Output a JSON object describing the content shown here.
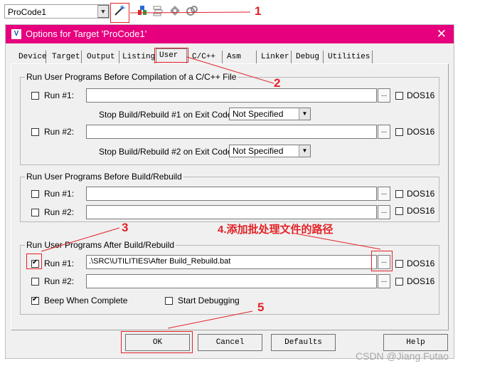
{
  "toolbar": {
    "target_value": "ProCode1",
    "icons": [
      "options-for-target-icon",
      "load-icon",
      "books-icon",
      "pack-installer-icon",
      "multi-project-icon"
    ]
  },
  "dialog": {
    "title": "Options for Target 'ProCode1'",
    "tabs": [
      "Device",
      "Target",
      "Output",
      "Listing",
      "User",
      "C/C++",
      "Asm",
      "Linker",
      "Debug",
      "Utilities"
    ],
    "active_tab": "User",
    "group_compile": {
      "legend": "Run User Programs Before Compilation of a C/C++ File",
      "run1_label": "Run #1:",
      "run1_value": "",
      "run1_checked": false,
      "run2_label": "Run #2:",
      "run2_value": "",
      "run2_checked": false,
      "dos16_label": "DOS16",
      "stop1_label": "Stop Build/Rebuild #1 on Exit Code:",
      "stop1_value": "Not Specified",
      "stop2_label": "Stop Build/Rebuild #2 on Exit Code:",
      "stop2_value": "Not Specified"
    },
    "group_before_build": {
      "legend": "Run User Programs Before Build/Rebuild",
      "run1_label": "Run #1:",
      "run1_value": "",
      "run2_label": "Run #2:",
      "run2_value": "",
      "dos16_label": "DOS16"
    },
    "group_after_build": {
      "legend": "Run User Programs After Build/Rebuild",
      "run1_label": "Run #1:",
      "run1_value": ".\\SRC\\UTILITIES\\After Build_Rebuild.bat",
      "run1_checked": true,
      "run2_label": "Run #2:",
      "run2_value": "",
      "dos16_label": "DOS16",
      "beep_label": "Beep When Complete",
      "beep_checked": true,
      "debug_label": "Start Debugging",
      "debug_checked": false
    },
    "browse_label": "...",
    "buttons": {
      "ok": "OK",
      "cancel": "Cancel",
      "defaults": "Defaults",
      "help": "Help"
    }
  },
  "annotations": {
    "n1": "1",
    "n2": "2",
    "n3": "3",
    "n4": "4.添加批处理文件的路径",
    "n5": "5",
    "color": "#e32227"
  },
  "watermark": "CSDN @Jiang Futao"
}
